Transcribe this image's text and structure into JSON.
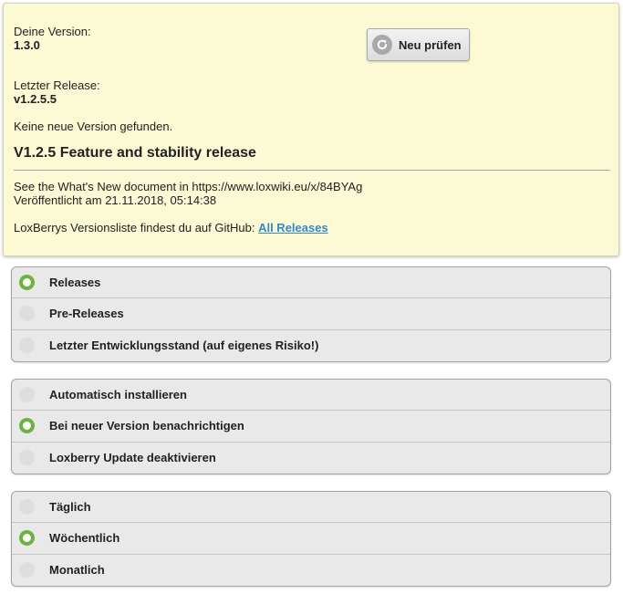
{
  "version_info": {
    "your_version_label": "Deine Version:",
    "your_version": "1.3.0",
    "latest_release_label": "Letzter Release:",
    "latest_release": "v1.2.5.5",
    "status_message": "Keine neue Version gefunden.",
    "check_button_label": "Neu prüfen",
    "release_title": "V1.2.5 Feature and stability release",
    "release_note": "See the What's New document in https://www.loxwiki.eu/x/84BYAg",
    "published": "Veröffentlicht am 21.11.2018, 05:14:38",
    "github_text": "LoxBerrys Versionsliste findest du auf GitHub: ",
    "github_link": "All Releases"
  },
  "release_channel": {
    "options": [
      {
        "label": "Releases",
        "selected": true
      },
      {
        "label": "Pre-Releases",
        "selected": false
      },
      {
        "label": "Letzter Entwicklungsstand (auf eigenes Risiko!)",
        "selected": false
      }
    ]
  },
  "install_mode": {
    "options": [
      {
        "label": "Automatisch installieren",
        "selected": false
      },
      {
        "label": "Bei neuer Version benachrichtigen",
        "selected": true
      },
      {
        "label": "Loxberry Update deaktivieren",
        "selected": false
      }
    ]
  },
  "check_interval": {
    "options": [
      {
        "label": "Täglich",
        "selected": false
      },
      {
        "label": "Wöchentlich",
        "selected": true
      },
      {
        "label": "Monatlich",
        "selected": false
      }
    ]
  },
  "colors": {
    "info_background": "#fbfad5",
    "radio_selected": "#6db33f",
    "link": "#3388cc",
    "group_background": "#e9e9e9"
  },
  "icons": {
    "check_button_icon": "refresh-icon"
  }
}
